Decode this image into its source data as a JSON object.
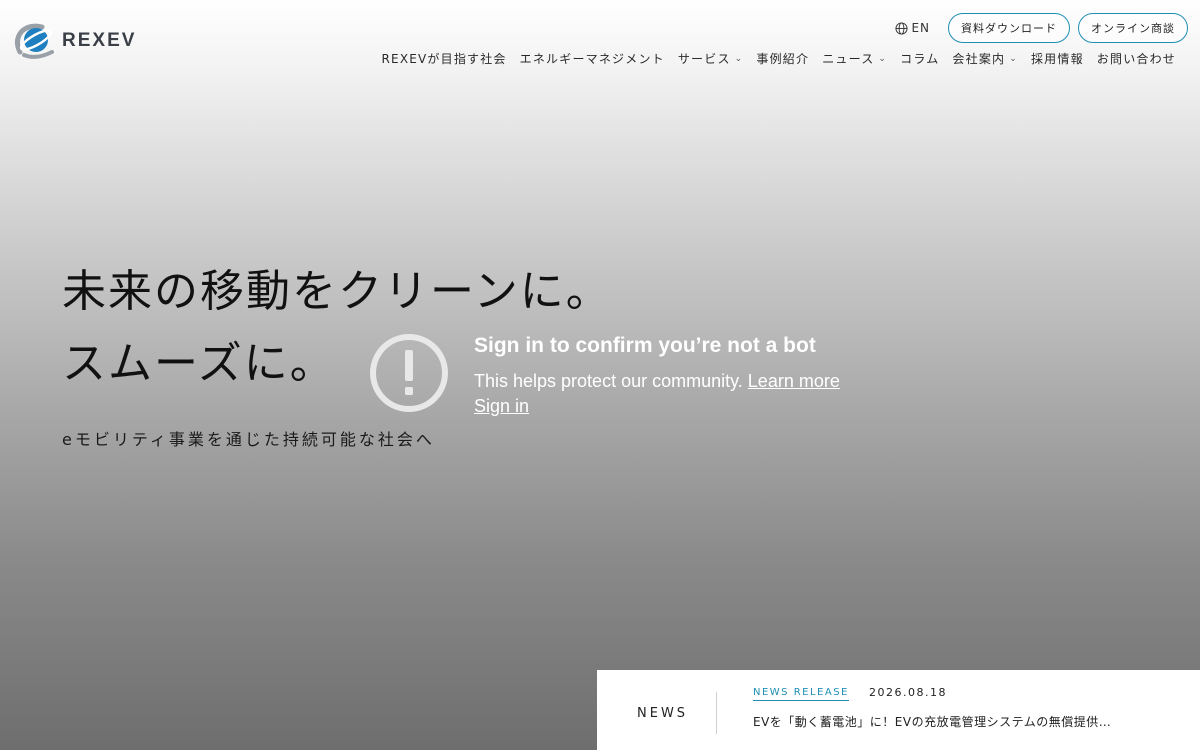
{
  "brand": {
    "name": "REXEV",
    "accent": "#1e8fb3"
  },
  "header": {
    "lang_label": "EN",
    "download_button": "資料ダウンロード",
    "consult_button": "オンライン商談",
    "nav": [
      "REXEVが目指す社会",
      "エネルギーマネジメント",
      "サービス",
      "事例紹介",
      "ニュース",
      "コラム",
      "会社案内",
      "採用情報",
      "お問い合わせ"
    ]
  },
  "hero": {
    "line1": "未来の移動をクリーンに。",
    "line2": "スムーズに。",
    "subtitle": "eモビリティ事業を通じた持続可能な社会へ"
  },
  "bot_check": {
    "title": "Sign in to confirm you’re not a bot",
    "message": "This helps protect our community.",
    "learn_more": "Learn more",
    "sign_in": "Sign in"
  },
  "news": {
    "label": "NEWS",
    "tag": "NEWS RELEASE",
    "date": "2026.08.18",
    "headline": "EVを「動く蓄電池」に！EVの充放電管理システムの無償提供…"
  }
}
